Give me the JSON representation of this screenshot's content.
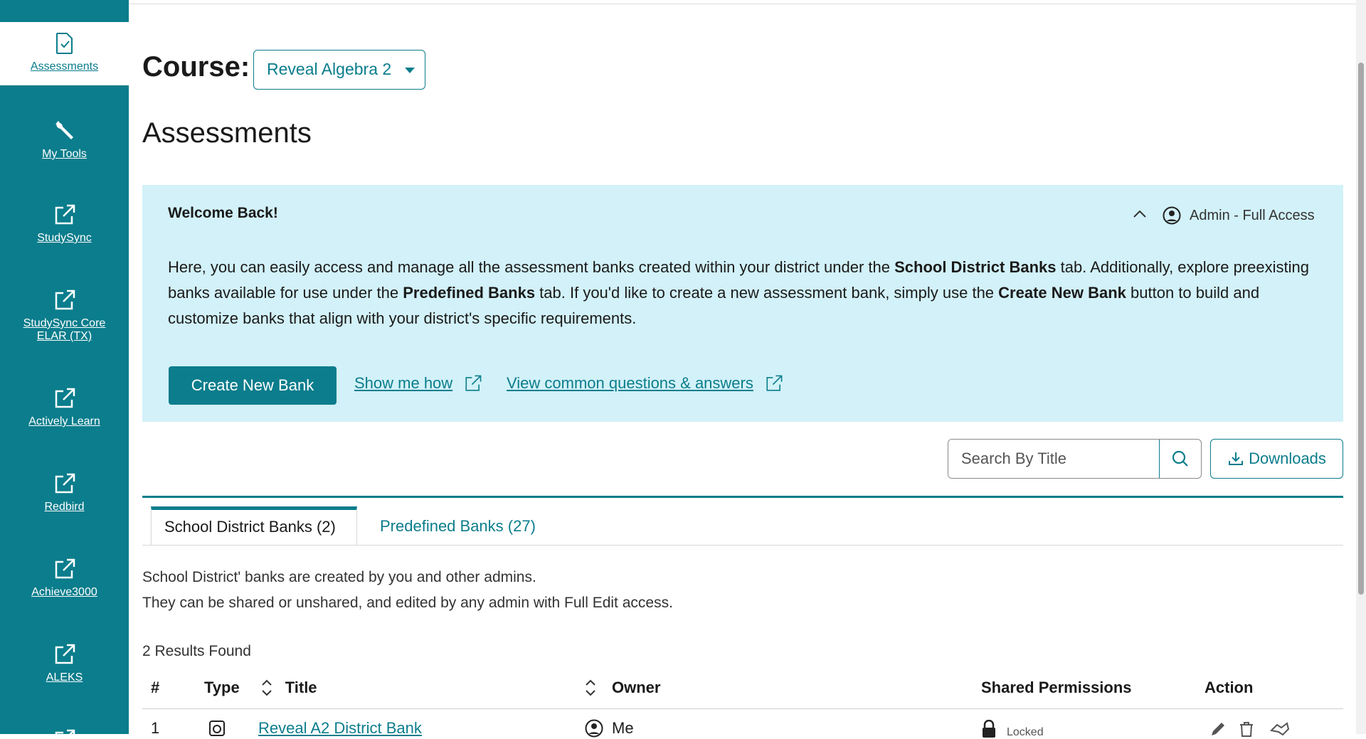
{
  "sidebar": {
    "items": [
      {
        "label": "Assessments",
        "icon": "document-check-icon",
        "active": true
      },
      {
        "label": "My Tools",
        "icon": "wrench-icon"
      },
      {
        "label": "StudySync",
        "icon": "external-link-icon"
      },
      {
        "label": "StudySync Core ELAR (TX)",
        "icon": "external-link-icon"
      },
      {
        "label": "Actively Learn",
        "icon": "external-link-icon"
      },
      {
        "label": "Redbird",
        "icon": "external-link-icon"
      },
      {
        "label": "Achieve3000",
        "icon": "external-link-icon"
      },
      {
        "label": "ALEKS",
        "icon": "external-link-icon"
      }
    ]
  },
  "header": {
    "course_label": "Course:",
    "course_value": "Reveal Algebra 2",
    "page_title": "Assessments"
  },
  "welcome": {
    "title": "Welcome Back!",
    "role": "Admin - Full Access",
    "body_1": "Here, you can easily access and manage all the assessment banks created within your district under the ",
    "body_b1": "School District Banks",
    "body_2": " tab. Additionally, explore preexisting banks available for use under the ",
    "body_b2": "Predefined Banks",
    "body_3": " tab. If you'd like to create a new assessment bank, simply use the ",
    "body_b3": "Create New Bank",
    "body_4": " button to build and customize banks that align with your district's specific requirements.",
    "create_button": "Create New Bank",
    "show_me_how": "Show me how ",
    "faq_link": "View common questions & answers "
  },
  "toolbar": {
    "search_placeholder": "Search By Title",
    "downloads_label": "Downloads"
  },
  "tabs": [
    {
      "label": "School District Banks (2)",
      "active": true
    },
    {
      "label": "Predefined Banks (27)",
      "active": false
    }
  ],
  "description": {
    "line1": "School District' banks are created by you and other admins.",
    "line2": "They can be shared or unshared, and edited by any admin with Full Edit access."
  },
  "results_text": "2 Results Found",
  "table": {
    "columns": {
      "num": "#",
      "type": "Type",
      "title": "Title",
      "owner": "Owner",
      "permissions": "Shared Permissions",
      "action": "Action"
    },
    "rows": [
      {
        "num": "1",
        "title": "Reveal A2 District Bank",
        "owner": "Me",
        "permissions": "Locked"
      }
    ]
  },
  "colors": {
    "brand": "#0b7d8c",
    "banner": "#d2f1f8"
  }
}
